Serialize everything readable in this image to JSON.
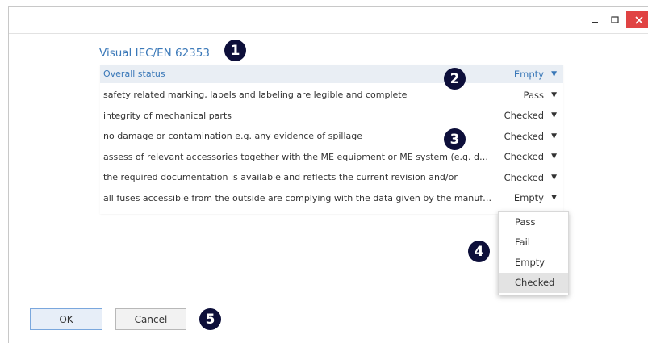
{
  "window": {
    "controls": {
      "minimize": "minimize-icon",
      "maximize": "maximize-icon",
      "close": "close-icon"
    }
  },
  "section": {
    "title": "Visual IEC/EN 62353"
  },
  "table": {
    "header": {
      "label": "Overall status",
      "value": "Empty"
    },
    "rows": [
      {
        "label": "safety related marking, labels and labeling are legible and complete",
        "value": "Pass"
      },
      {
        "label": "integrity of mechanical parts",
        "value": "Checked"
      },
      {
        "label": "no damage or contamination e.g. any evidence of spillage",
        "value": "Checked"
      },
      {
        "label": "assess of relevant accessories together with the ME equipment or ME system  (e.g. deta...",
        "value": "Checked"
      },
      {
        "label": "the required documentation is available and reflects the current revision and/or",
        "value": "Checked"
      },
      {
        "label": "all fuses accessible from the outside are complying with the data given by the manufac...",
        "value": "Empty"
      }
    ]
  },
  "dropdown": {
    "options": [
      "Pass",
      "Fail",
      "Empty",
      "Checked"
    ],
    "highlighted": "Checked"
  },
  "badges": [
    "1",
    "2",
    "3",
    "4",
    "5"
  ],
  "buttons": {
    "ok": "OK",
    "cancel": "Cancel"
  },
  "colors": {
    "accent": "#3a78b8",
    "badge": "#0d0f3a",
    "close": "#e04343"
  }
}
